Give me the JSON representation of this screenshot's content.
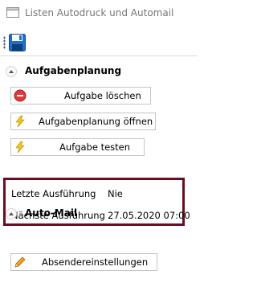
{
  "window": {
    "title": "Listen Autodruck und Automail"
  },
  "toolbar": {
    "save_icon": "save-icon"
  },
  "sections": {
    "aufgabenplanung": {
      "label": "Aufgabenplanung",
      "buttons": [
        {
          "label": "Aufgabe löschen",
          "icon": "delete-icon"
        },
        {
          "label": "Aufgabenplanung öffnen",
          "icon": "lightning-icon"
        },
        {
          "label": "Aufgabe testen",
          "icon": "lightning-icon"
        }
      ]
    },
    "status": {
      "last_run_label": "Letzte Ausführung",
      "last_run_value": "Nie",
      "next_run_label": "Nächste Ausführung",
      "next_run_value": "27.05.2020 07:00"
    },
    "automail": {
      "label": "Auto-Mail",
      "buttons": [
        {
          "label": "Absendereinstellungen",
          "icon": "pencil-icon"
        }
      ]
    }
  },
  "colors": {
    "highlight_border": "#6a0c22",
    "title_text": "#777777"
  }
}
